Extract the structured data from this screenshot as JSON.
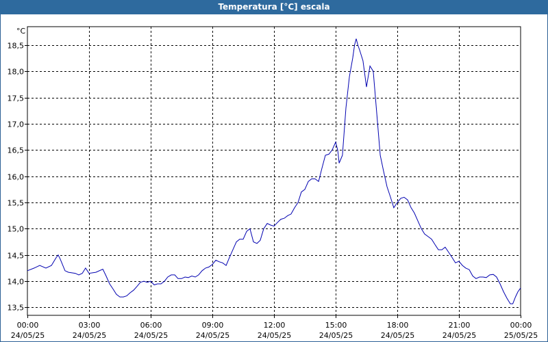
{
  "window": {
    "title": "Temperatura [°C] escala"
  },
  "chart_data": {
    "type": "line",
    "title": "Temperatura [°C] escala",
    "ylabel": "°C",
    "xlabel": "",
    "ylim": [
      13.35,
      18.85
    ],
    "xlim": [
      0,
      24
    ],
    "grid": true,
    "y_ticks": [
      13.5,
      14.0,
      14.5,
      15.0,
      15.5,
      16.0,
      16.5,
      17.0,
      17.5,
      18.0,
      18.5
    ],
    "y_tick_labels": [
      "13,5",
      "14,0",
      "14,5",
      "15,0",
      "15,5",
      "16,0",
      "16,5",
      "17,0",
      "17,5",
      "18,0",
      "18,5"
    ],
    "x_ticks": [
      {
        "hour": 0,
        "time": "00:00",
        "date": "24/05/25"
      },
      {
        "hour": 3,
        "time": "03:00",
        "date": "24/05/25"
      },
      {
        "hour": 6,
        "time": "06:00",
        "date": "24/05/25"
      },
      {
        "hour": 9,
        "time": "09:00",
        "date": "24/05/25"
      },
      {
        "hour": 12,
        "time": "12:00",
        "date": "24/05/25"
      },
      {
        "hour": 15,
        "time": "15:00",
        "date": "24/05/25"
      },
      {
        "hour": 18,
        "time": "18:00",
        "date": "24/05/25"
      },
      {
        "hour": 21,
        "time": "21:00",
        "date": "24/05/25"
      },
      {
        "hour": 24,
        "time": "00:00",
        "date": "25/05/25"
      }
    ],
    "series": [
      {
        "color": "#0000b0",
        "points": [
          [
            0.0,
            14.2
          ],
          [
            0.33,
            14.25
          ],
          [
            0.6,
            14.3
          ],
          [
            0.9,
            14.25
          ],
          [
            1.17,
            14.3
          ],
          [
            1.4,
            14.45
          ],
          [
            1.5,
            14.5
          ],
          [
            1.6,
            14.42
          ],
          [
            1.83,
            14.2
          ],
          [
            2.0,
            14.17
          ],
          [
            2.33,
            14.15
          ],
          [
            2.5,
            14.12
          ],
          [
            2.67,
            14.15
          ],
          [
            2.83,
            14.25
          ],
          [
            3.0,
            14.15
          ],
          [
            3.33,
            14.17
          ],
          [
            3.67,
            14.23
          ],
          [
            3.83,
            14.1
          ],
          [
            4.0,
            13.95
          ],
          [
            4.17,
            13.85
          ],
          [
            4.33,
            13.75
          ],
          [
            4.5,
            13.7
          ],
          [
            4.67,
            13.7
          ],
          [
            4.83,
            13.72
          ],
          [
            5.0,
            13.78
          ],
          [
            5.17,
            13.83
          ],
          [
            5.33,
            13.9
          ],
          [
            5.5,
            13.98
          ],
          [
            5.67,
            14.0
          ],
          [
            5.83,
            13.98
          ],
          [
            6.0,
            14.0
          ],
          [
            6.17,
            13.93
          ],
          [
            6.33,
            13.95
          ],
          [
            6.5,
            13.95
          ],
          [
            6.67,
            14.0
          ],
          [
            6.83,
            14.08
          ],
          [
            7.0,
            14.12
          ],
          [
            7.17,
            14.12
          ],
          [
            7.33,
            14.05
          ],
          [
            7.5,
            14.05
          ],
          [
            7.67,
            14.08
          ],
          [
            7.83,
            14.07
          ],
          [
            8.0,
            14.1
          ],
          [
            8.17,
            14.08
          ],
          [
            8.33,
            14.12
          ],
          [
            8.5,
            14.2
          ],
          [
            8.67,
            14.25
          ],
          [
            8.83,
            14.27
          ],
          [
            9.0,
            14.32
          ],
          [
            9.17,
            14.4
          ],
          [
            9.33,
            14.37
          ],
          [
            9.5,
            14.35
          ],
          [
            9.67,
            14.3
          ],
          [
            9.83,
            14.45
          ],
          [
            10.0,
            14.6
          ],
          [
            10.17,
            14.75
          ],
          [
            10.33,
            14.8
          ],
          [
            10.5,
            14.8
          ],
          [
            10.67,
            14.95
          ],
          [
            10.83,
            15.0
          ],
          [
            11.0,
            14.75
          ],
          [
            11.17,
            14.72
          ],
          [
            11.33,
            14.78
          ],
          [
            11.5,
            15.0
          ],
          [
            11.67,
            15.1
          ],
          [
            11.83,
            15.07
          ],
          [
            12.0,
            15.05
          ],
          [
            12.17,
            15.12
          ],
          [
            12.33,
            15.18
          ],
          [
            12.5,
            15.2
          ],
          [
            12.67,
            15.25
          ],
          [
            12.83,
            15.28
          ],
          [
            13.0,
            15.4
          ],
          [
            13.17,
            15.5
          ],
          [
            13.33,
            15.7
          ],
          [
            13.5,
            15.75
          ],
          [
            13.67,
            15.9
          ],
          [
            13.83,
            15.95
          ],
          [
            14.0,
            15.95
          ],
          [
            14.17,
            15.9
          ],
          [
            14.33,
            16.15
          ],
          [
            14.5,
            16.4
          ],
          [
            14.67,
            16.42
          ],
          [
            14.83,
            16.5
          ],
          [
            15.0,
            16.65
          ],
          [
            15.1,
            16.5
          ],
          [
            15.17,
            16.25
          ],
          [
            15.33,
            16.4
          ],
          [
            15.5,
            17.3
          ],
          [
            15.67,
            17.9
          ],
          [
            15.83,
            18.25
          ],
          [
            15.92,
            18.5
          ],
          [
            16.0,
            18.62
          ],
          [
            16.08,
            18.5
          ],
          [
            16.17,
            18.4
          ],
          [
            16.33,
            18.2
          ],
          [
            16.5,
            17.7
          ],
          [
            16.67,
            18.1
          ],
          [
            16.83,
            18.0
          ],
          [
            17.0,
            17.2
          ],
          [
            17.17,
            16.4
          ],
          [
            17.33,
            16.1
          ],
          [
            17.5,
            15.8
          ],
          [
            17.67,
            15.6
          ],
          [
            17.83,
            15.4
          ],
          [
            18.0,
            15.5
          ],
          [
            18.17,
            15.58
          ],
          [
            18.33,
            15.6
          ],
          [
            18.5,
            15.55
          ],
          [
            18.67,
            15.4
          ],
          [
            18.83,
            15.3
          ],
          [
            19.0,
            15.15
          ],
          [
            19.17,
            15.0
          ],
          [
            19.33,
            14.9
          ],
          [
            19.5,
            14.85
          ],
          [
            19.67,
            14.8
          ],
          [
            19.83,
            14.7
          ],
          [
            20.0,
            14.6
          ],
          [
            20.17,
            14.6
          ],
          [
            20.33,
            14.65
          ],
          [
            20.5,
            14.55
          ],
          [
            20.67,
            14.45
          ],
          [
            20.83,
            14.35
          ],
          [
            21.0,
            14.38
          ],
          [
            21.17,
            14.3
          ],
          [
            21.33,
            14.25
          ],
          [
            21.5,
            14.22
          ],
          [
            21.67,
            14.1
          ],
          [
            21.83,
            14.05
          ],
          [
            22.0,
            14.08
          ],
          [
            22.17,
            14.08
          ],
          [
            22.33,
            14.07
          ],
          [
            22.5,
            14.12
          ],
          [
            22.67,
            14.13
          ],
          [
            22.83,
            14.08
          ],
          [
            23.0,
            13.95
          ],
          [
            23.17,
            13.8
          ],
          [
            23.33,
            13.68
          ],
          [
            23.5,
            13.57
          ],
          [
            23.62,
            13.57
          ],
          [
            23.75,
            13.7
          ],
          [
            23.87,
            13.8
          ],
          [
            24.0,
            13.87
          ]
        ]
      }
    ]
  }
}
